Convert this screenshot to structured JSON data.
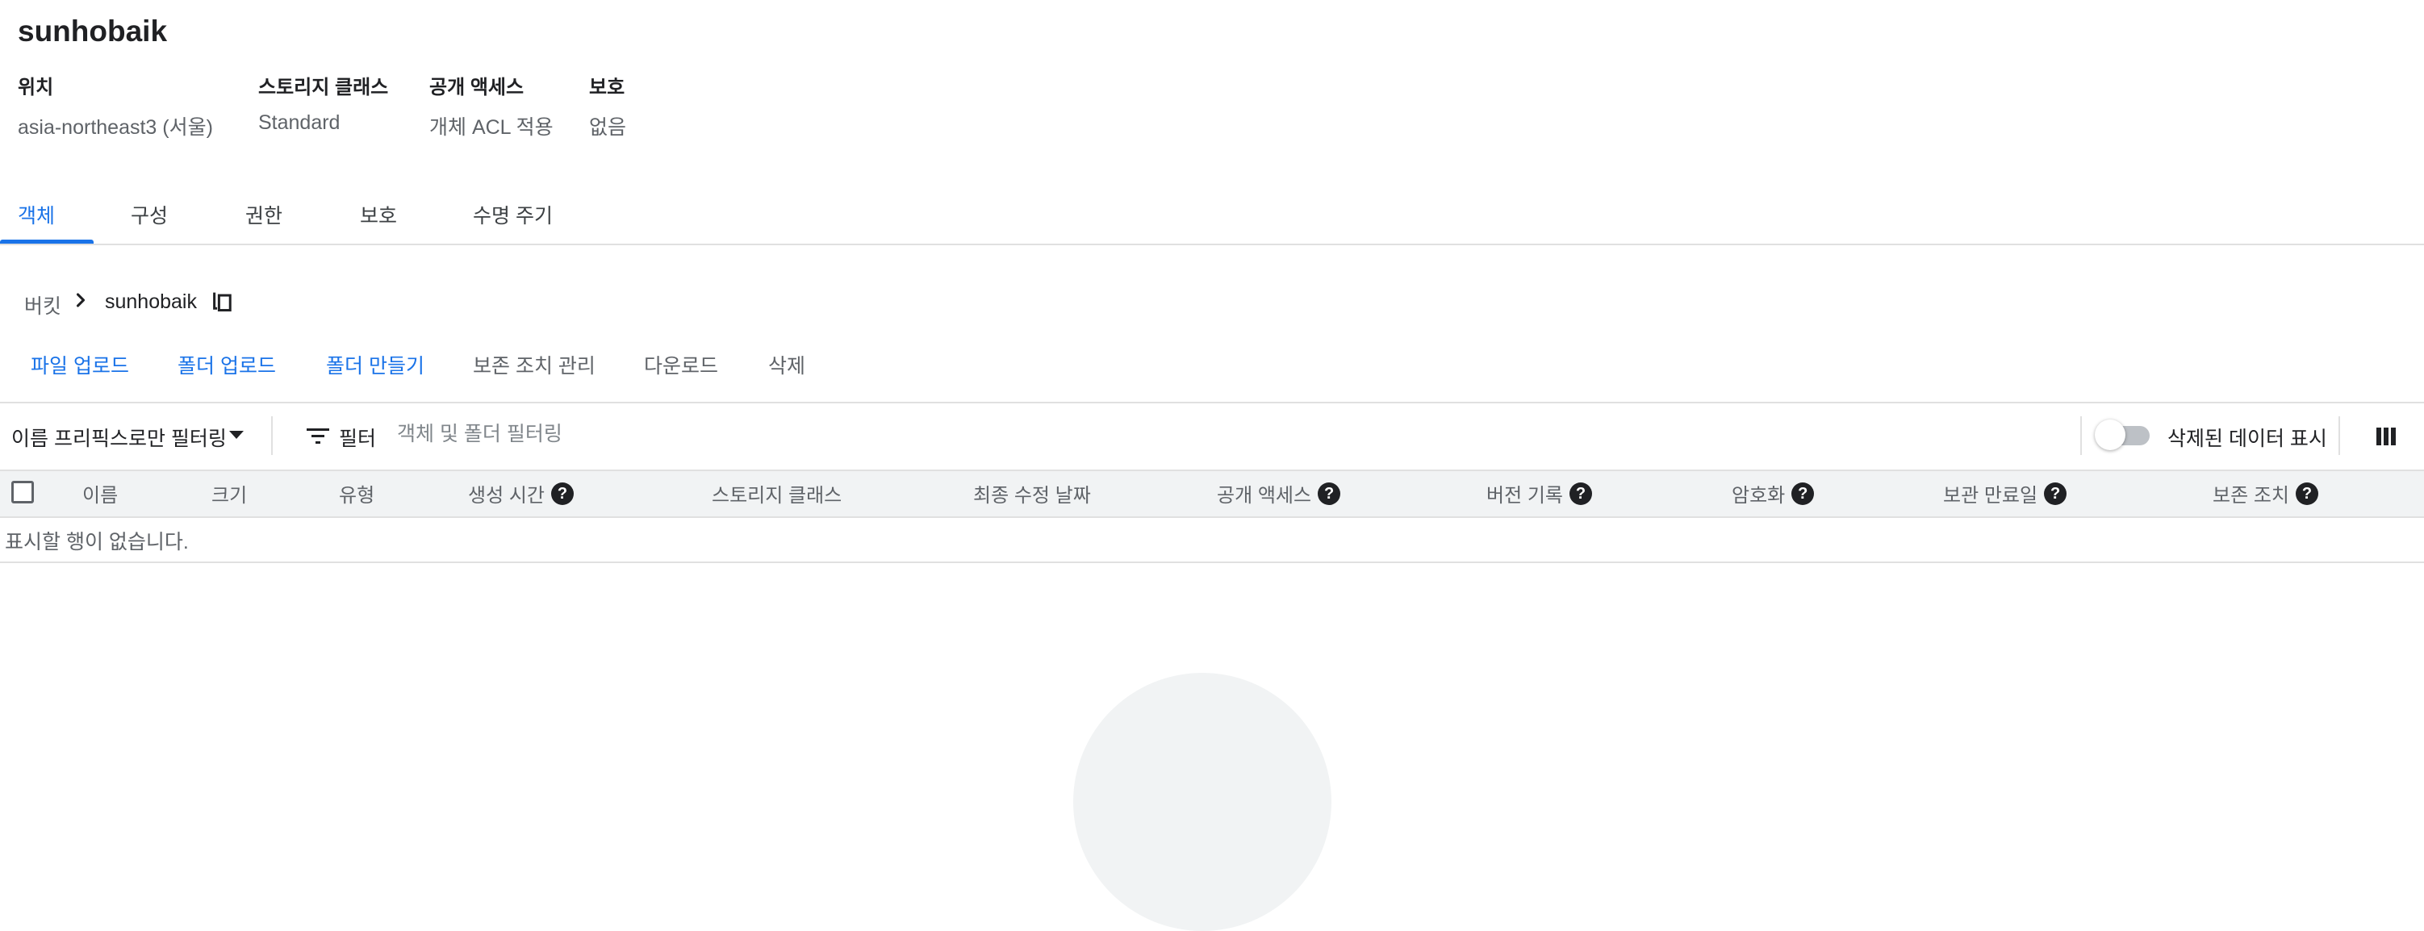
{
  "header": {
    "title": "sunhobaik",
    "properties": [
      {
        "label": "위치",
        "value": "asia-northeast3 (서울)"
      },
      {
        "label": "스토리지 클래스",
        "value": "Standard"
      },
      {
        "label": "공개 액세스",
        "value": "개체 ACL 적용"
      },
      {
        "label": "보호",
        "value": "없음"
      }
    ]
  },
  "tabs": [
    {
      "label": "객체",
      "active": true
    },
    {
      "label": "구성"
    },
    {
      "label": "권한"
    },
    {
      "label": "보호"
    },
    {
      "label": "수명 주기"
    }
  ],
  "breadcrumb": {
    "root": "버킷",
    "current": "sunhobaik"
  },
  "actions": [
    {
      "label": "파일 업로드",
      "enabled": true
    },
    {
      "label": "폴더 업로드",
      "enabled": true
    },
    {
      "label": "폴더 만들기",
      "enabled": true
    },
    {
      "label": "보존 조치 관리",
      "enabled": false
    },
    {
      "label": "다운로드",
      "enabled": false
    },
    {
      "label": "삭제",
      "enabled": false
    }
  ],
  "filter_bar": {
    "prefix_filter_label": "이름 프리픽스로만 필터링",
    "filter_label": "필터",
    "filter_placeholder": "객체 및 폴더 필터링",
    "show_deleted_label": "삭제된 데이터 표시",
    "show_deleted_on": false
  },
  "table": {
    "columns": [
      {
        "label": "이름",
        "help": false
      },
      {
        "label": "크기",
        "help": false
      },
      {
        "label": "유형",
        "help": false
      },
      {
        "label": "생성 시간",
        "help": true
      },
      {
        "label": "스토리지 클래스",
        "help": false
      },
      {
        "label": "최종 수정 날짜",
        "help": false
      },
      {
        "label": "공개 액세스",
        "help": true
      },
      {
        "label": "버전 기록",
        "help": true
      },
      {
        "label": "암호화",
        "help": true
      },
      {
        "label": "보관 만료일",
        "help": true
      },
      {
        "label": "보존 조치",
        "help": true
      }
    ],
    "empty_message": "표시할 행이 없습니다."
  },
  "colors": {
    "accent": "#1a73e8",
    "text": "#202124",
    "muted": "#5f6368",
    "header_bg": "#f1f3f4"
  }
}
